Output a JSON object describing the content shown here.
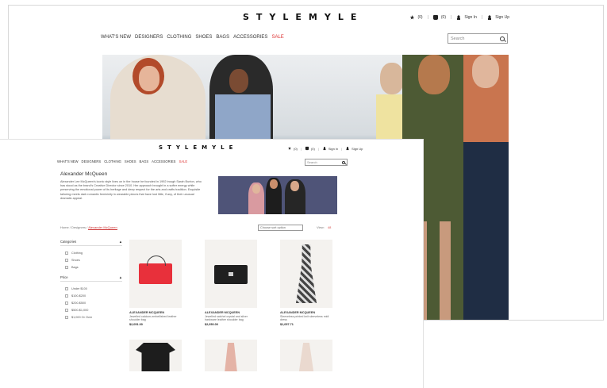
{
  "logo": "STYLEMYLE",
  "account": {
    "wishlist_count": "(0)",
    "cart_count": "(0)",
    "sign_in": "Sign In",
    "sign_up": "Sign Up",
    "sign_in_small": "Sign in",
    "sign_up_small": "Sign Up"
  },
  "nav": {
    "items": [
      "WHAT'S NEW",
      "DESIGNERS",
      "CLOTHING",
      "SHOES",
      "BAGS",
      "ACCESSORIES",
      "SALE"
    ]
  },
  "search": {
    "placeholder": "Search"
  },
  "brand": {
    "title": "Alexander McQueen",
    "description": "Alexander Lee McQueen's iconic style lives on in the house he founded in 1992 trough Sarah Burton, who has stood as the brand's Creative Director since 2010. Her approach brought in a softer energy while preserving the emotional power of its heritage and deep respect for the arts and crafts tradition. Exquisite tailoring meets dark romantic femininity in wearable pieces that have lost little, if any, of their unusual dramatic appeal."
  },
  "breadcrumb": {
    "home": "Home",
    "designers": "Designers",
    "current": "Alexander McQueen",
    "sep": "/"
  },
  "sort": {
    "placeholder": "Choose sort option"
  },
  "view": {
    "label": "View:",
    "value": "48"
  },
  "filters": {
    "categories": {
      "title": "Categories",
      "toggle": "▲",
      "options": [
        "Clothing",
        "Shoes",
        "Bags"
      ]
    },
    "price": {
      "title": "Price",
      "toggle": "▲",
      "options": [
        "Under $100",
        "$100-$200",
        "$200-$500",
        "$500-$1,000",
        "$1,000 Or Over"
      ]
    }
  },
  "products": [
    {
      "brand": "ALEXANDER MCQUEEN",
      "name": "Jewelled calcium-embellished leather shoulder bag",
      "price": "$2,051.00"
    },
    {
      "brand": "ALEXANDER MCQUEEN",
      "name": "Jewelled satchel crystal and silver hardware leather shoulder bag",
      "price": "$2,050.00"
    },
    {
      "brand": "ALEXANDER MCQUEEN",
      "name": "Sleeveless printed knit sleeveless midi dress",
      "price": "$1,057.71"
    }
  ]
}
